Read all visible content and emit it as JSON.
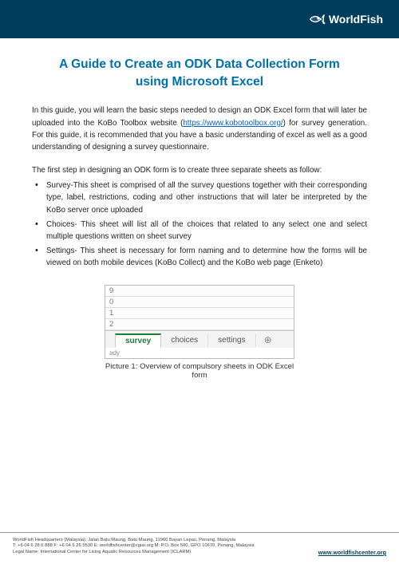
{
  "header": {
    "brand": "WorldFish"
  },
  "title_line1": "A Guide to Create an ODK Data Collection Form",
  "title_line2": "using Microsoft Excel",
  "intro": {
    "pre": "In this guide, you will learn the basic steps needed to design an ODK Excel form that will later be uploaded into the KoBo Toolbox website (",
    "link_text": "https://www.kobotoolbox.org/",
    "post": ") for survey generation. For this guide, it is recommended that you have a basic understanding of excel as well as a good understanding of designing a survey questionnaire."
  },
  "steps_lead": "The first step in designing an ODK form is to create three separate sheets as follow:",
  "bullets": [
    "Survey-This sheet is comprised of all the survey questions together with their corresponding type, label, restrictions, coding and other instructions that will later be interpreted by the KoBo server once uploaded",
    "Choices- This sheet will list all of the choices that related to any select one and select multiple questions written on sheet survey",
    "Settings- This sheet is necessary for form naming and to determine how the forms will be viewed on both mobile devices (KoBo Collect) and the KoBo web page (Enketo)"
  ],
  "excel": {
    "rows": [
      "9",
      "0",
      "1",
      "2"
    ],
    "tabs": [
      "survey",
      "choices",
      "settings"
    ],
    "active_tab_index": 0,
    "status": "ady"
  },
  "caption": "Picture 1: Overview of compulsory sheets in ODK Excel form",
  "footer": {
    "line1": "WorldFish Headquarters (Malaysia), Jalan Batu Maung, Batu Maung, 11960 Bayan Lepas, Penang, Malaysia",
    "line2": "T: +6 04 6 28 6 888    F: +6 04 6 26 5530    E: worldfishcenter@cgiar.org    M: P.O. Box 500, GPO 10670, Penang, Malaysia",
    "line3": "Legal Name: International Center for Living Aquatic Resources Management (ICLARM)",
    "url": "www.worldfishcenter.org"
  }
}
